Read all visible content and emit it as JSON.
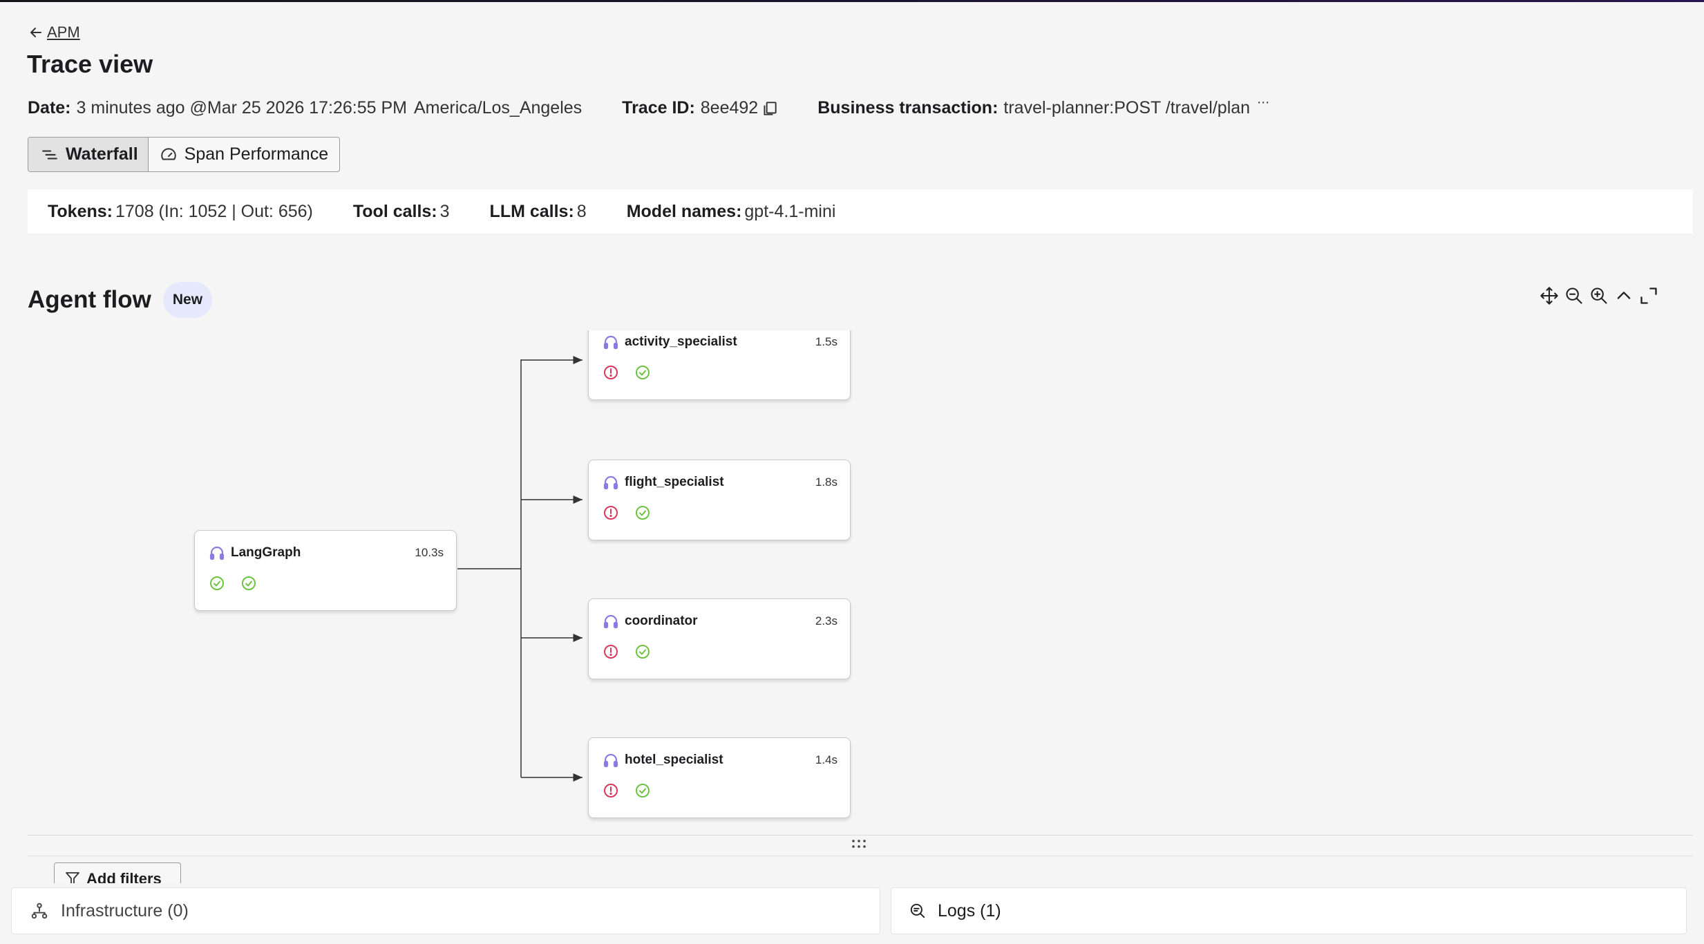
{
  "nav": {
    "back_label": "APM"
  },
  "page": {
    "title": "Trace view"
  },
  "meta": {
    "date_label": "Date:",
    "date_value": "3 minutes ago @Mar 25 2026 17:26:55 PM",
    "timezone": "America/Los_Angeles",
    "trace_id_label": "Trace ID:",
    "trace_id_value": "8ee492",
    "business_label": "Business transaction:",
    "business_value": "travel-planner:POST /travel/plan",
    "more_glyph": "⋯"
  },
  "tabs": [
    {
      "label": "Waterfall",
      "icon": "waterfall-icon",
      "active": true
    },
    {
      "label": "Span Performance",
      "icon": "gauge-icon",
      "active": false
    }
  ],
  "stats": {
    "tokens_label": "Tokens:",
    "tokens_value": "1708 (In: 1052 | Out: 656)",
    "tool_calls_label": "Tool calls:",
    "tool_calls_value": "3",
    "llm_calls_label": "LLM calls:",
    "llm_calls_value": "8",
    "model_names_label": "Model names:",
    "model_names_value": "gpt-4.1-mini"
  },
  "agent_flow": {
    "title": "Agent flow",
    "badge": "New",
    "tools": [
      "pan-icon",
      "zoom-out-icon",
      "zoom-in-icon",
      "collapse-icon",
      "expand-icon"
    ],
    "nodes": [
      {
        "name": "LangGraph",
        "duration": "10.3s",
        "icon": "headset-icon",
        "status": [
          "success",
          "success"
        ]
      },
      {
        "name": "activity_specialist",
        "duration": "1.5s",
        "icon": "headset-icon",
        "status": [
          "error",
          "success"
        ]
      },
      {
        "name": "flight_specialist",
        "duration": "1.8s",
        "icon": "headset-icon",
        "status": [
          "error",
          "success"
        ]
      },
      {
        "name": "coordinator",
        "duration": "2.3s",
        "icon": "headset-icon",
        "status": [
          "error",
          "success"
        ]
      },
      {
        "name": "hotel_specialist",
        "duration": "1.4s",
        "icon": "headset-icon",
        "status": [
          "error",
          "success"
        ]
      }
    ]
  },
  "filters": {
    "add_label": "Add filters"
  },
  "bottom": {
    "infra_label": "Infrastructure (0)",
    "logs_label": "Logs (1)"
  },
  "colors": {
    "accent_purple": "#8b7be0",
    "success_green": "#6cc241",
    "error_red": "#d9385a",
    "badge_bg": "#e6e8fb"
  }
}
